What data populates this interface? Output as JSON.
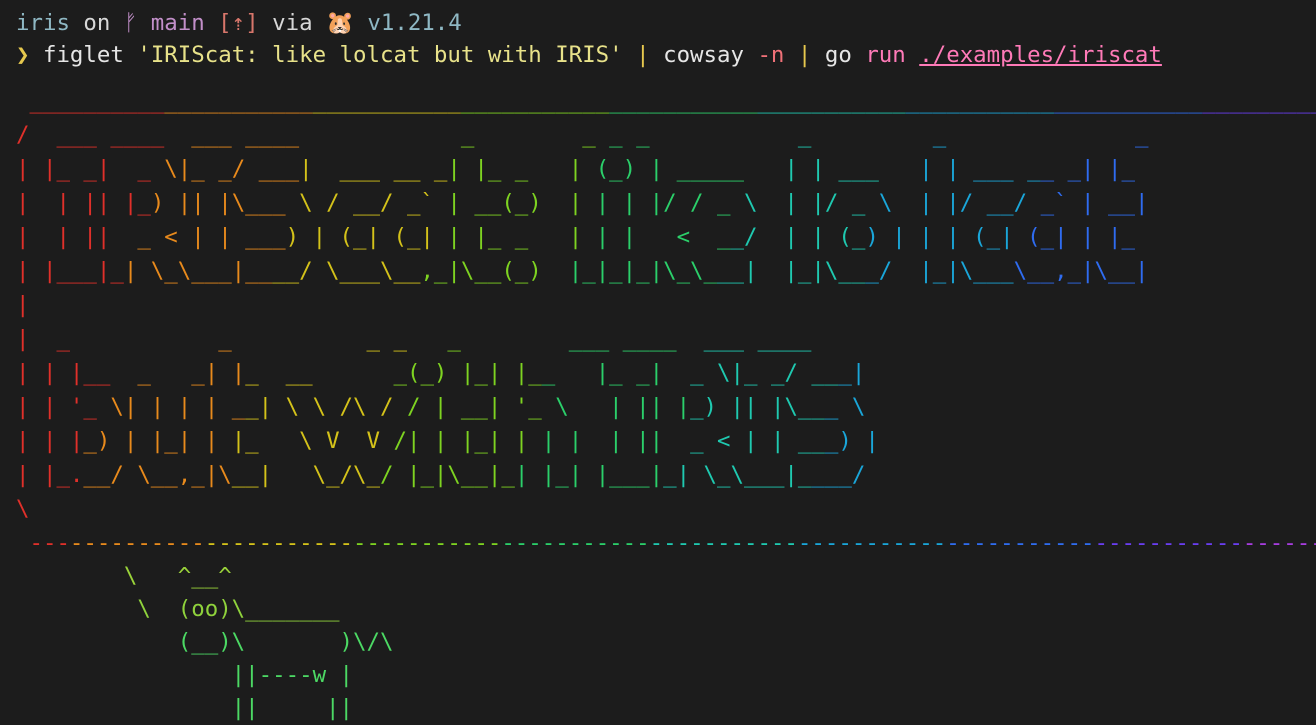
{
  "prompt": {
    "segments": [
      {
        "text": "iris",
        "color": "#8fb8c4"
      },
      {
        "text": " on ",
        "color": "#d8d8d8"
      },
      {
        "text": "ᚠ main",
        "color": "#c28fc9"
      },
      {
        "text": " ",
        "color": "#d8d8d8"
      },
      {
        "text": "[⇡]",
        "color": "#d8766b"
      },
      {
        "text": " via ",
        "color": "#d8d8d8"
      },
      {
        "text": "🐹 v1.21.4",
        "color": "#8fb8c4"
      }
    ]
  },
  "command": {
    "segments": [
      {
        "text": "❯ ",
        "color": "#e6c84e"
      },
      {
        "text": "figlet",
        "color": "#e6e6e6"
      },
      {
        "text": " ",
        "color": "#e6e6e6"
      },
      {
        "text": "'IRIScat: like lolcat but with IRIS'",
        "color": "#e8e28a"
      },
      {
        "text": " ",
        "color": "#e6e6e6"
      },
      {
        "text": "|",
        "color": "#e6c84e"
      },
      {
        "text": " cowsay ",
        "color": "#e6e6e6"
      },
      {
        "text": "-n",
        "color": "#f07178"
      },
      {
        "text": " ",
        "color": "#e6e6e6"
      },
      {
        "text": "|",
        "color": "#e6c84e"
      },
      {
        "text": " go ",
        "color": "#e6e6e6"
      },
      {
        "text": "run",
        "color": "#ff7ab8"
      },
      {
        "text": " ",
        "color": "#e6e6e6"
      },
      {
        "text": "./examples/iriscat",
        "color": "#ff7ab8",
        "underline": true
      }
    ]
  },
  "cowsay_output": {
    "gradient_colors": [
      "#e0302a",
      "#e88a1c",
      "#d4c21a",
      "#7ed321",
      "#2bcf6a",
      "#1fc9b0",
      "#1aa6d9",
      "#2f6cf0",
      "#6a3ef2",
      "#a83de0",
      "#e0288f"
    ],
    "lines": [
      " ____________________________________________________________________________________________________",
      "/  ___ ____  ___ ____            _        _ _ _           _         _              _               \\",
      "| |_ _|  _ \\|_ _/ ___|  ___ __ _| |_ _   | (_) | _____   | | ___   | | ___ __ _| |_              |",
      "|  | || |_) || |\\___ \\ / __/ _` | __(_)  | | | |/ / _ \\  | |/ _ \\  | |/ __/ _` | __|             |",
      "|  | ||  _ < | | ___) | (_| (_| | |_ _   | | |   <  __/  | | (_) | | | (_| (_| | |_              |",
      "| |___|_| \\_\\___|____/ \\___\\__,_|\\__(_)  |_|_|_|\\_\\___|  |_|\\___/  |_|\\___\\__,_|\\__|             |",
      "|                                                                                                  |",
      "|  _           _          _ _   _        ___ ____  ___ ____                                        |",
      "| | |__  _   _| |_  __      _(_) |_| |__   |_ _|  _ \\|_ _/ ___|                                  |",
      "| | '_ \\| | | | __| \\ \\ /\\ / / | __| '_ \\   | || |_) || |\\___ \\                                  |",
      "| | |_) | |_| | |_   \\ V  V /| | |_| | | |  | ||  _ < | | ___) |                                 |",
      "| |_.__/ \\__,_|\\__|   \\_/\\_/ |_|\\__|_| |_| |___|_| \\_\\___|____/                                  |",
      "\\                                                                                                  /",
      " ----------------------------------------------------------------------------------------------------"
    ],
    "cow_lines": [
      "        \\   ^__^",
      "         \\  (oo)\\_______",
      "            (__)\\       )\\/\\",
      "                ||----w |",
      "                ||     ||"
    ],
    "cow_color": "#4cd964"
  }
}
